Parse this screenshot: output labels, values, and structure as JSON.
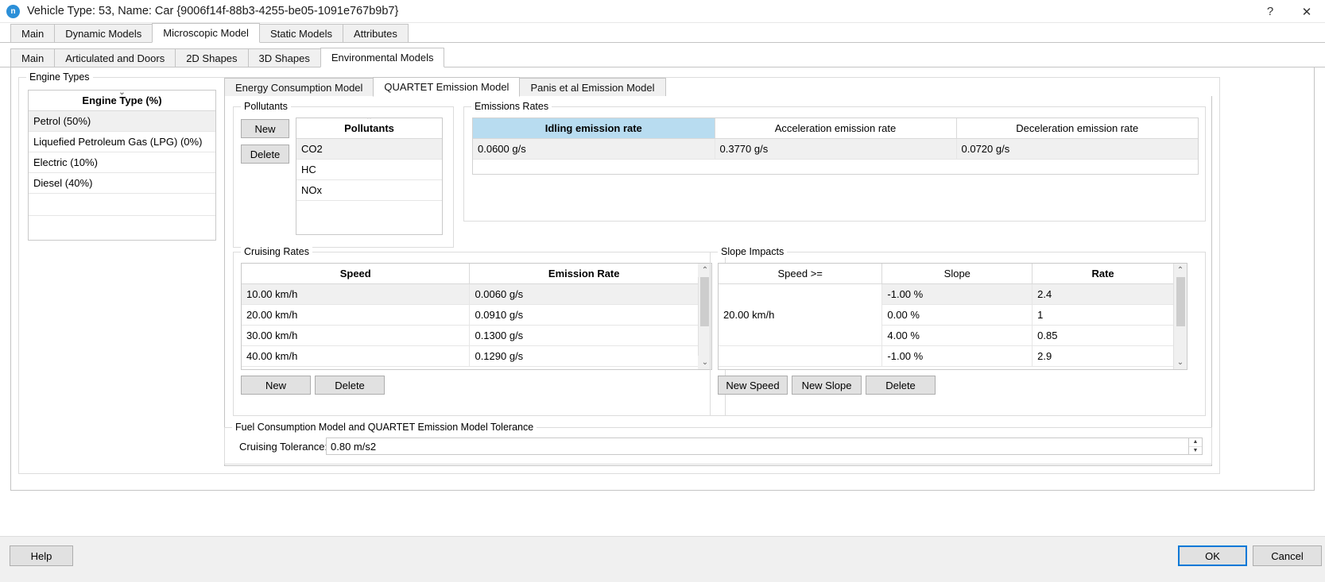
{
  "window": {
    "title": "Vehicle Type: 53, Name: Car  {9006f14f-88b3-4255-be05-1091e767b9b7}",
    "app_icon_glyph": "n",
    "help_icon": "?",
    "close_icon": "✕"
  },
  "outer_tabs": [
    {
      "label": "Main",
      "active": false
    },
    {
      "label": "Dynamic Models",
      "active": false
    },
    {
      "label": "Microscopic Model",
      "active": true
    },
    {
      "label": "Static Models",
      "active": false
    },
    {
      "label": "Attributes",
      "active": false
    }
  ],
  "inner_tabs": [
    {
      "label": "Main",
      "active": false
    },
    {
      "label": "Articulated and Doors",
      "active": false
    },
    {
      "label": "2D Shapes",
      "active": false
    },
    {
      "label": "3D Shapes",
      "active": false
    },
    {
      "label": "Environmental Models",
      "active": true
    }
  ],
  "engine_types": {
    "group_title": "Engine Types",
    "header": "Engine Type (%)",
    "sort_glyph": "⌄",
    "rows": [
      "Petrol (50%)",
      "Liquefied Petroleum Gas (LPG) (0%)",
      "Electric (10%)",
      "Diesel (40%)"
    ]
  },
  "model_tabs": [
    {
      "label": "Energy Consumption Model",
      "active": false
    },
    {
      "label": "QUARTET Emission Model",
      "active": true
    },
    {
      "label": "Panis et al Emission Model",
      "active": false
    }
  ],
  "pollutants": {
    "group_title": "Pollutants",
    "new_label": "New",
    "delete_label": "Delete",
    "header": "Pollutants",
    "sort_glyph": "⌃",
    "rows": [
      "CO2",
      "HC",
      "NOx"
    ]
  },
  "emissions_rates": {
    "group_title": "Emissions Rates",
    "columns": [
      "Idling emission rate",
      "Acceleration emission rate",
      "Deceleration emission rate"
    ],
    "selected_column": 0,
    "values": [
      "0.0600 g/s",
      "0.3770 g/s",
      "0.0720 g/s"
    ]
  },
  "cruising_rates": {
    "group_title": "Cruising Rates",
    "columns": [
      "Speed",
      "Emission Rate"
    ],
    "rows": [
      {
        "speed": "10.00 km/h",
        "rate": "0.0060 g/s"
      },
      {
        "speed": "20.00 km/h",
        "rate": "0.0910 g/s"
      },
      {
        "speed": "30.00 km/h",
        "rate": "0.1300 g/s"
      },
      {
        "speed": "40.00 km/h",
        "rate": "0.1290 g/s"
      }
    ],
    "new_label": "New",
    "delete_label": "Delete",
    "scroll_up_glyph": "⌃",
    "scroll_down_glyph": "⌄"
  },
  "slope_impacts": {
    "group_title": "Slope Impacts",
    "columns": [
      "Speed >=",
      "Slope",
      "Rate"
    ],
    "bold_column": 2,
    "speed_group_label": "20.00 km/h",
    "rows": [
      {
        "slope": "-1.00 %",
        "rate": "2.4"
      },
      {
        "slope": "0.00 %",
        "rate": "1"
      },
      {
        "slope": "4.00 %",
        "rate": "0.85"
      },
      {
        "slope": "-1.00 %",
        "rate": "2.9"
      }
    ],
    "new_speed_label": "New Speed",
    "new_slope_label": "New Slope",
    "delete_label": "Delete",
    "scroll_up_glyph": "⌃",
    "scroll_down_glyph": "⌄"
  },
  "tolerance": {
    "group_title": "Fuel Consumption Model and QUARTET Emission Model Tolerance",
    "label": "Cruising Tolerance:",
    "value": "0.80 m/s2",
    "spin_up_glyph": "▲",
    "spin_down_glyph": "▼"
  },
  "footer": {
    "help_label": "Help",
    "ok_label": "OK",
    "cancel_label": "Cancel"
  },
  "colors": {
    "accent": "#0078d7",
    "selected_header": "#b8dcf0",
    "alt_row": "#f0f0f0",
    "button_face": "#e1e1e1"
  }
}
